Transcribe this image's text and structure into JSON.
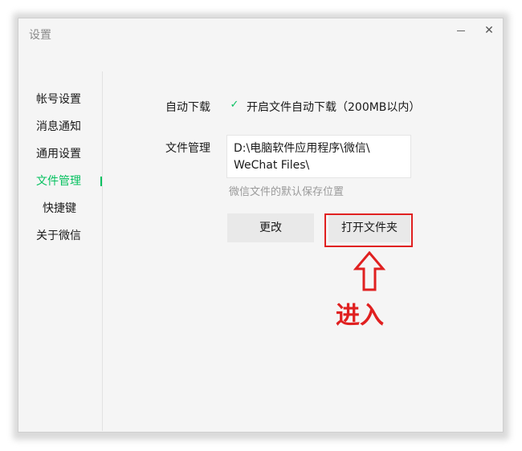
{
  "window": {
    "title": "设置",
    "close_glyph": "✕"
  },
  "sidebar": {
    "items": [
      {
        "label": "帐号设置",
        "active": false
      },
      {
        "label": "消息通知",
        "active": false
      },
      {
        "label": "通用设置",
        "active": false
      },
      {
        "label": "文件管理",
        "active": true
      },
      {
        "label": "快捷键",
        "active": false
      },
      {
        "label": "关于微信",
        "active": false
      }
    ]
  },
  "main": {
    "auto_download": {
      "label": "自动下载",
      "checkbox_label": "开启文件自动下载（200MB以内）",
      "checked": true
    },
    "file_management": {
      "label": "文件管理",
      "path_line1": "D:\\电脑软件应用程序\\微信\\",
      "path_line2": "WeChat Files\\",
      "hint": "微信文件的默认保存位置"
    },
    "buttons": {
      "change": "更改",
      "open_folder": "打开文件夹"
    }
  },
  "annotation": {
    "text": "进入",
    "color": "#e02020"
  },
  "colors": {
    "accent": "#07c160",
    "annotation_red": "#e02020",
    "window_bg": "#f5f5f5"
  },
  "icons": {
    "checkbox": "checkmark-icon",
    "minimize": "minimize-icon",
    "close": "close-icon",
    "arrow": "up-arrow-icon"
  }
}
